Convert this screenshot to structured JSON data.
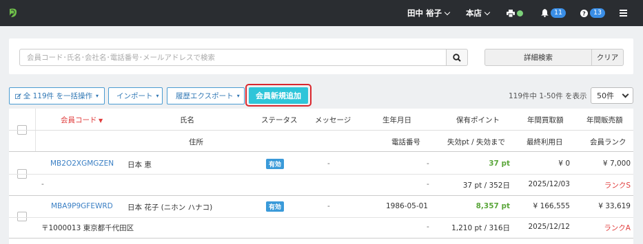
{
  "topbar": {
    "user_name": "田中 裕子",
    "store": "本店",
    "notification_count": "11",
    "help_count": "13"
  },
  "search": {
    "placeholder": "会員コード･氏名･会社名･電話番号･メールアドレスで検索",
    "advanced_label": "詳細検索",
    "clear_label": "クリア"
  },
  "actions": {
    "bulk_label": "全 119件 を一括操作",
    "import_label": "インポート",
    "export_label": "履歴エクスポート",
    "new_member_label": "会員新規追加",
    "count_text": "119件中 1-50件 を表示",
    "per_page": "50件"
  },
  "table": {
    "headers_row1": {
      "code": "会員コード",
      "name": "氏名",
      "status": "ステータス",
      "message": "メッセージ",
      "birthday": "生年月日",
      "points": "保有ポイント",
      "annual_buy": "年間買取額",
      "annual_sell": "年間販売額"
    },
    "headers_row2": {
      "address": "住所",
      "phone": "電話番号",
      "expire": "失効pt / 失効まで",
      "last_used": "最終利用日",
      "rank": "会員ランク"
    },
    "rows": [
      {
        "code": "MB2O2XGMGZEN",
        "name": "日本 恵",
        "status": "有効",
        "message": "-",
        "birthday": "-",
        "points": "37 pt",
        "annual_buy": "¥ 0",
        "annual_sell": "¥ 7,000",
        "address": "-",
        "phone": "-",
        "expire": "37 pt / 352日",
        "last_used": "2025/12/03",
        "rank": "ランクS"
      },
      {
        "code": "MBA9P9GFEWRD",
        "name": "日本 花子 (ニホン ハナコ)",
        "status": "有効",
        "message": "-",
        "birthday": "1986-05-01",
        "points": "8,357 pt",
        "annual_buy": "¥ 166,555",
        "annual_sell": "¥ 33,619",
        "address": "〒1000013 東京都千代田区",
        "phone": "-",
        "expire": "1,210 pt / 316日",
        "last_used": "2025/12/12",
        "rank": "ランクA"
      }
    ]
  },
  "colors": {
    "topbar": "#2a2d31",
    "accent_new": "#2ec5d9",
    "highlight": "#d9262d",
    "link": "#3a7fc4",
    "points_green": "#5aa63a",
    "rank_red": "#e03d3d"
  }
}
